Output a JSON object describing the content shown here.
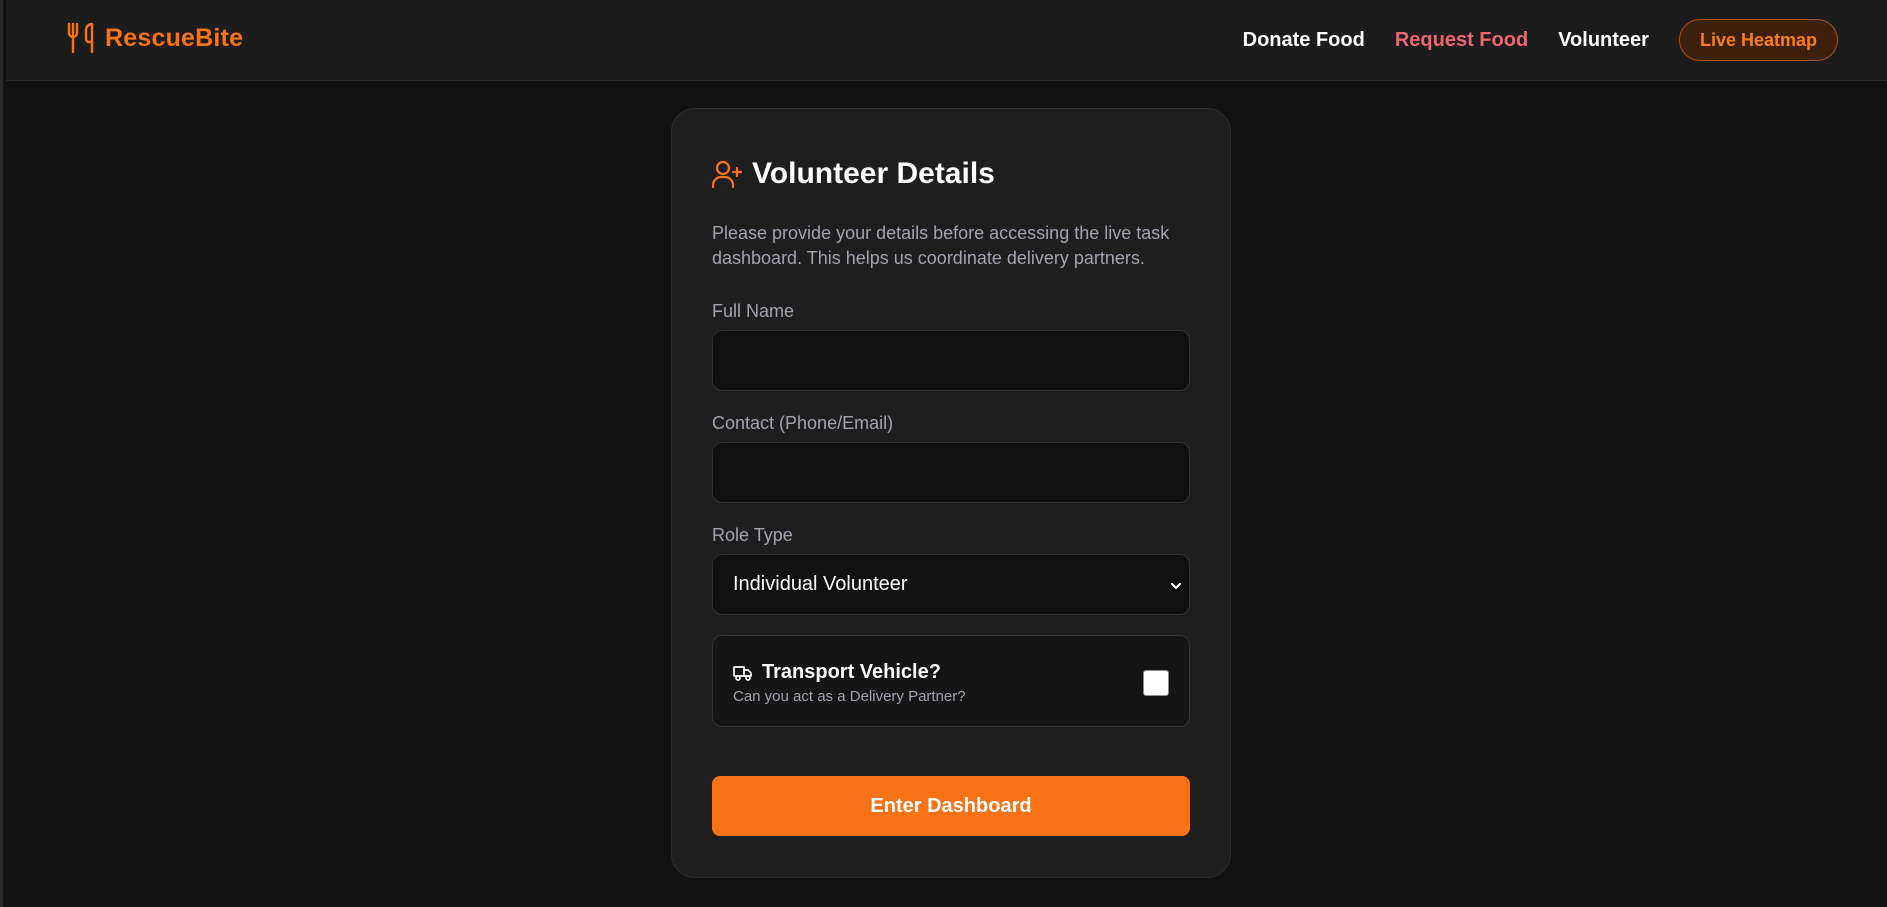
{
  "brand": {
    "name": "RescueBite",
    "icon": "utensils-icon",
    "color": "#f97316"
  },
  "nav": {
    "links": [
      {
        "label": "Donate Food",
        "color": "#ffffff"
      },
      {
        "label": "Request Food",
        "color": "#f0666e"
      },
      {
        "label": "Volunteer",
        "color": "#ffffff"
      }
    ],
    "cta_label": "Live Heatmap"
  },
  "form": {
    "title": "Volunteer Details",
    "title_icon": "user-plus-icon",
    "description": "Please provide your details before accessing the live task dashboard. This helps us coordinate delivery partners.",
    "full_name": {
      "label": "Full Name",
      "value": "",
      "placeholder": ""
    },
    "contact": {
      "label": "Contact (Phone/Email)",
      "value": "",
      "placeholder": ""
    },
    "role": {
      "label": "Role Type",
      "selected": "Individual Volunteer"
    },
    "vehicle": {
      "icon": "truck-icon",
      "title": "Transport Vehicle?",
      "subtitle": "Can you act as a Delivery Partner?",
      "checked": false
    },
    "submit_label": "Enter Dashboard"
  },
  "colors": {
    "accent": "#f97316",
    "background": "#121212",
    "card": "#1e1e1e",
    "navbar": "#1c1c1c",
    "muted_text": "#a3a3b0"
  }
}
